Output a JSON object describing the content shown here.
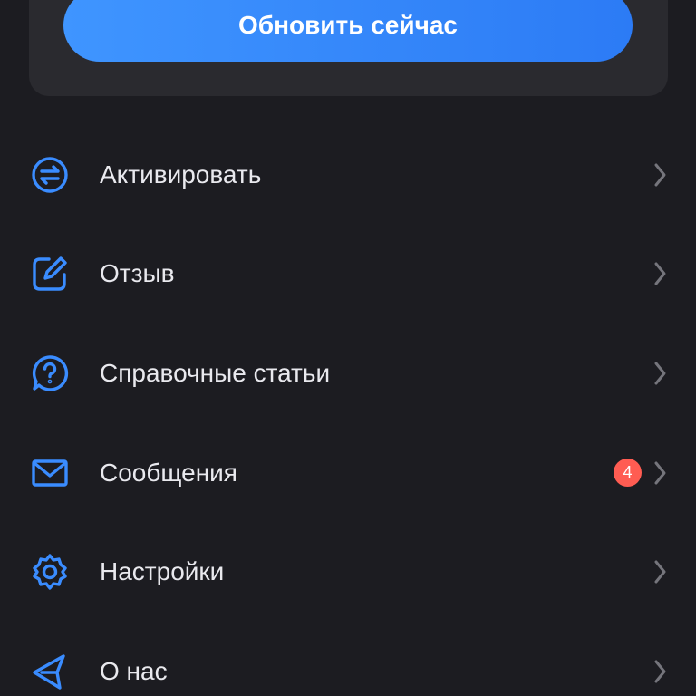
{
  "update": {
    "button_label": "Обновить сейчас"
  },
  "colors": {
    "accent": "#3a8cff",
    "background": "#1c1c21",
    "card": "#2a2a2f",
    "badge": "#ff5c52",
    "chevron": "#75757c"
  },
  "menu": {
    "items": [
      {
        "label": "Активировать",
        "icon": "swap-arrows-icon"
      },
      {
        "label": "Отзыв",
        "icon": "edit-icon"
      },
      {
        "label": "Справочные статьи",
        "icon": "help-bubble-icon"
      },
      {
        "label": "Сообщения",
        "icon": "mail-icon",
        "badge": "4"
      },
      {
        "label": "Настройки",
        "icon": "gear-icon"
      },
      {
        "label": "О нас",
        "icon": "send-icon"
      }
    ]
  }
}
